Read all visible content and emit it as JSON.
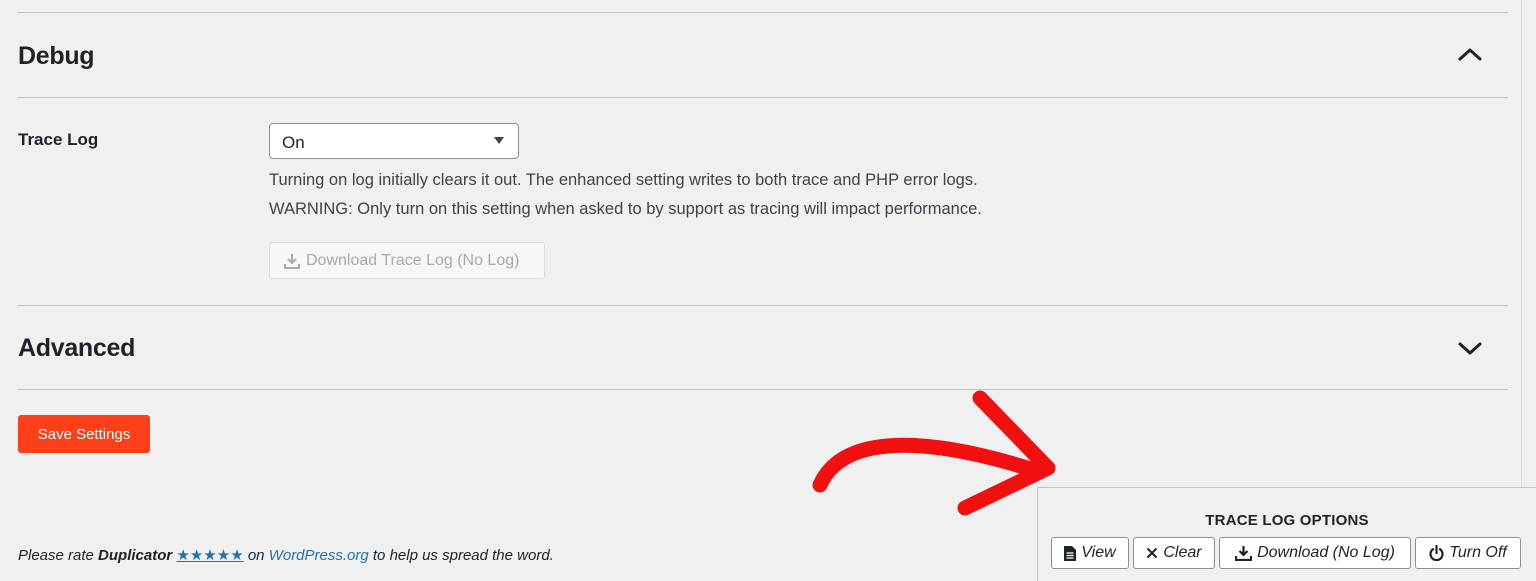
{
  "debug": {
    "title": "Debug",
    "trace_log": {
      "label": "Trace Log",
      "selected": "On",
      "description_1": "Turning on log initially clears it out. The enhanced setting writes to both trace and PHP error logs.",
      "description_2": "WARNING: Only turn on this setting when asked to by support as tracing will impact performance.",
      "download_label": "Download Trace Log (No Log)"
    }
  },
  "advanced": {
    "title": "Advanced"
  },
  "save_label": "Save Settings",
  "footer": {
    "prefix": "Please rate ",
    "product": "Duplicator",
    "stars": "★★★★★",
    "on": " on ",
    "link": "WordPress.org",
    "suffix": " to help us spread the word."
  },
  "trace_panel": {
    "title": "TRACE LOG OPTIONS",
    "view": "View",
    "clear": "Clear",
    "download": "Download (No Log)",
    "turn_off": "Turn Off"
  },
  "colors": {
    "accent": "#fe3f1a",
    "arrow": "#f20f0f",
    "link": "#2271b1"
  }
}
